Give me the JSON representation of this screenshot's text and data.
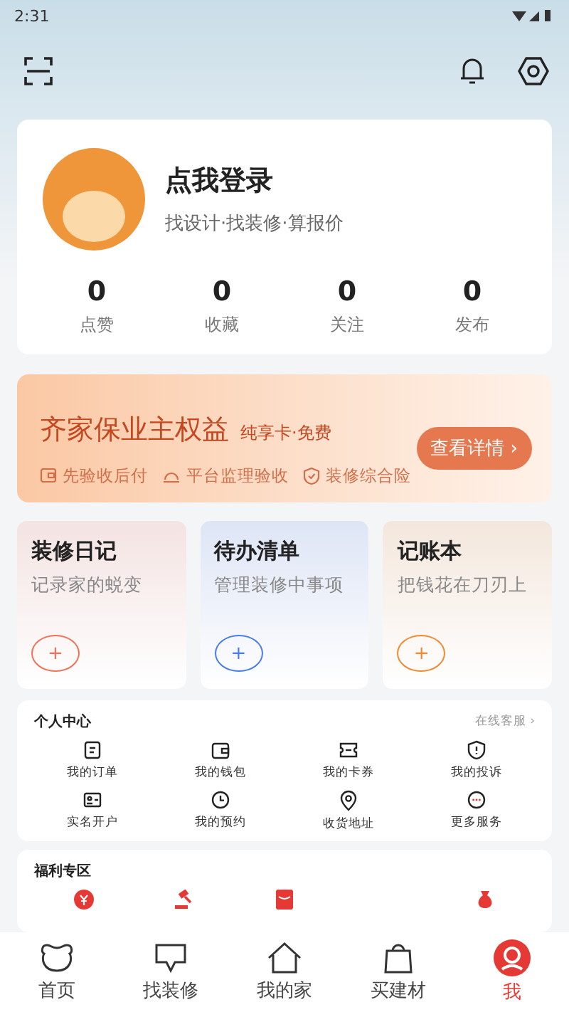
{
  "status_bar": {
    "time": "2:31"
  },
  "profile": {
    "title": "点我登录",
    "subtitle": "找设计·找装修·算报价",
    "stats": [
      {
        "value": "0",
        "label": "点赞"
      },
      {
        "value": "0",
        "label": "收藏"
      },
      {
        "value": "0",
        "label": "关注"
      },
      {
        "value": "0",
        "label": "发布"
      }
    ]
  },
  "banner": {
    "title": "齐家保业主权益",
    "tag": "纯享卡·免费",
    "button": "查看详情 ›",
    "features": [
      {
        "kind": "pay",
        "label": "先验收后付"
      },
      {
        "kind": "inspect",
        "label": "平台监理验收"
      },
      {
        "kind": "insure",
        "label": "装修综合险"
      }
    ]
  },
  "tools": [
    {
      "title": "装修日记",
      "subtitle": "记录家的蜕变",
      "color": "#f0705a",
      "add": "+"
    },
    {
      "title": "待办清单",
      "subtitle": "管理装修中事项",
      "color": "#4a7be8",
      "add": "+"
    },
    {
      "title": "记账本",
      "subtitle": "把钱花在刀刃上",
      "color": "#f08a30",
      "add": "+"
    }
  ],
  "personal_center": {
    "title": "个人中心",
    "service": "在线客服 ›",
    "items": [
      {
        "kind": "order",
        "label": "我的订单"
      },
      {
        "kind": "wallet",
        "label": "我的钱包"
      },
      {
        "kind": "coupon",
        "label": "我的卡券"
      },
      {
        "kind": "complaint",
        "label": "我的投诉"
      },
      {
        "kind": "id",
        "label": "实名开户"
      },
      {
        "kind": "clock",
        "label": "我的预约"
      },
      {
        "kind": "pin",
        "label": "收货地址"
      },
      {
        "kind": "more",
        "label": "更多服务"
      }
    ]
  },
  "welfare": {
    "title": "福利专区",
    "items": [
      {
        "kind": "yen"
      },
      {
        "kind": "gavel"
      },
      {
        "kind": "envelope"
      },
      {
        "kind": "hidden"
      },
      {
        "kind": "bag"
      }
    ]
  },
  "tabs": [
    {
      "kind": "home",
      "label": "首页",
      "selected": false
    },
    {
      "kind": "find",
      "label": "找装修",
      "selected": false
    },
    {
      "kind": "house",
      "label": "我的家",
      "selected": false
    },
    {
      "kind": "shop",
      "label": "买建材",
      "selected": false
    },
    {
      "kind": "me",
      "label": "我",
      "selected": true
    }
  ]
}
